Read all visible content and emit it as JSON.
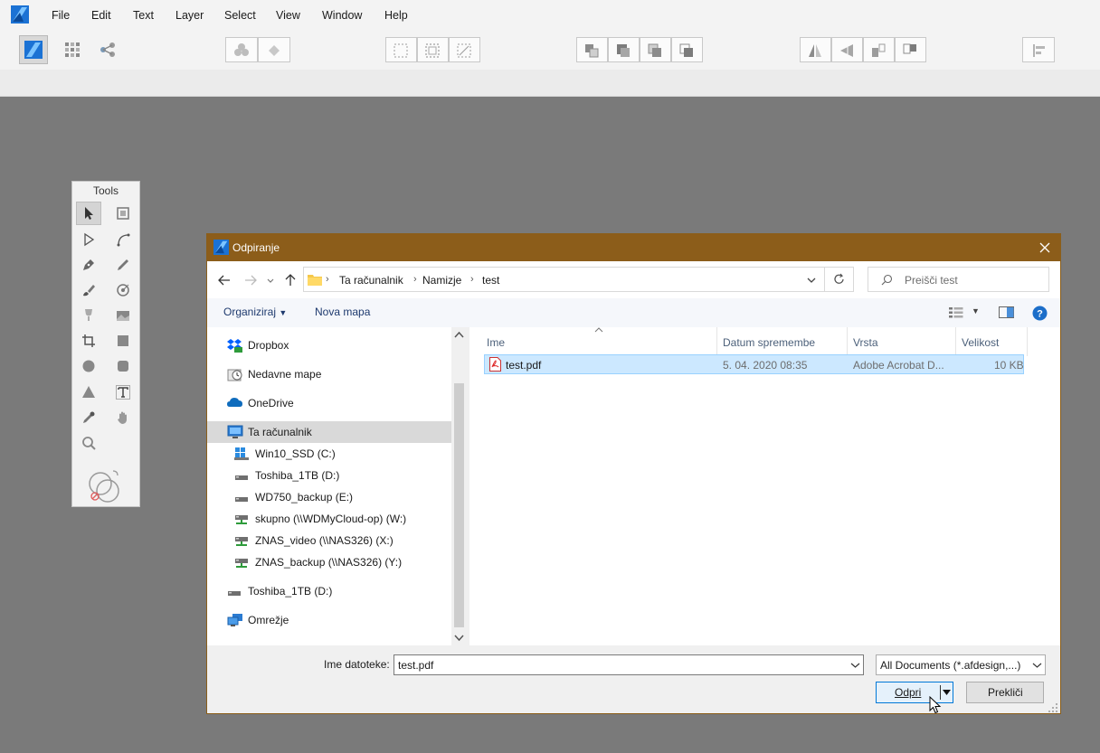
{
  "menubar": {
    "items": [
      "File",
      "Edit",
      "Text",
      "Layer",
      "Select",
      "View",
      "Window",
      "Help"
    ]
  },
  "toolbar": {
    "personas": [
      "designer-persona-icon",
      "pixel-persona-icon",
      "export-persona-icon"
    ]
  },
  "tools_panel": {
    "title": "Tools"
  },
  "dialog": {
    "title": "Odpiranje",
    "breadcrumb": [
      "Ta računalnik",
      "Namizje",
      "test"
    ],
    "search_placeholder": "Preišči test",
    "commands": {
      "organize": "Organiziraj",
      "new_folder": "Nova mapa"
    },
    "nav_items": [
      {
        "label": "Dropbox",
        "icon": "dropbox-icon"
      },
      {
        "label": "Nedavne mape",
        "icon": "recent-folders-icon"
      },
      {
        "label": "OneDrive",
        "icon": "onedrive-cloud-icon"
      },
      {
        "label": "Ta računalnik",
        "icon": "computer-icon",
        "selected": true
      },
      {
        "label": "Win10_SSD (C:)",
        "icon": "windows-drive-icon"
      },
      {
        "label": "Toshiba_1TB (D:)",
        "icon": "drive-icon"
      },
      {
        "label": "WD750_backup (E:)",
        "icon": "drive-icon"
      },
      {
        "label": "skupno (\\\\WDMyCloud-op) (W:)",
        "icon": "network-drive-icon"
      },
      {
        "label": "ZNAS_video (\\\\NAS326) (X:)",
        "icon": "network-drive-icon"
      },
      {
        "label": "ZNAS_backup (\\\\NAS326) (Y:)",
        "icon": "network-drive-icon"
      },
      {
        "label": "Toshiba_1TB (D:)",
        "icon": "drive-icon"
      },
      {
        "label": "Omrežje",
        "icon": "network-icon"
      }
    ],
    "columns": [
      "Ime",
      "Datum spremembe",
      "Vrsta",
      "Velikost"
    ],
    "files": [
      {
        "name": "test.pdf",
        "date": "5. 04. 2020 08:35",
        "type": "Adobe Acrobat D...",
        "size": "10 KB"
      }
    ],
    "filename_label": "Ime datoteke:",
    "filename_value": "test.pdf",
    "filetype_value": "All Documents (*.afdesign,...)",
    "open_label": "Odpri",
    "cancel_label": "Prekliči"
  },
  "colors": {
    "dialog_title_bar": "#8c5d1a",
    "canvas_background": "#7a7a7a",
    "selection": "#cce8ff",
    "accent": "#0078d7"
  }
}
